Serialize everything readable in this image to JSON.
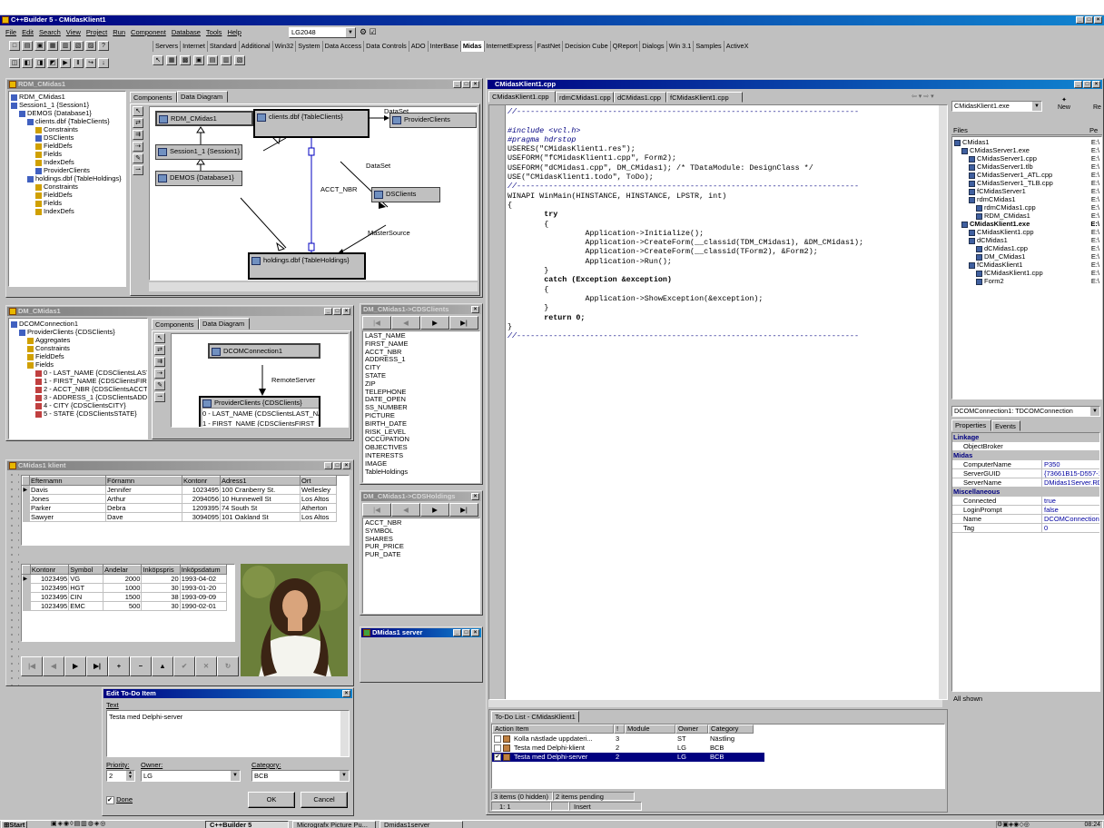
{
  "ide": {
    "title": "C++Builder 5 - CMidasKlient1",
    "menu": [
      "File",
      "Edit",
      "Search",
      "View",
      "Project",
      "Run",
      "Component",
      "Database",
      "Tools",
      "Help"
    ],
    "config_combo": "LG2048",
    "palette_tabs": [
      "Servers",
      "Internet",
      "Standard",
      "Additional",
      "Win32",
      "System",
      "Data Access",
      "Data Controls",
      "ADO",
      "InterBase",
      "Midas",
      "InternetExpress",
      "FastNet",
      "Decision Cube",
      "QReport",
      "Dialogs",
      "Win 3.1",
      "Samples",
      "ActiveX"
    ],
    "selected_palette_tab": "Midas"
  },
  "rdm": {
    "title": "RDM_CMidas1",
    "tree": [
      "RDM_CMidas1",
      "Session1_1 {Session1}",
      "DEMOS {Database1}",
      "clients.dbf {TableClients}",
      "Constraints",
      "DSClients",
      "FieldDefs",
      "Fields",
      "IndexDefs",
      "ProviderClients",
      "holdings.dbf {TableHoldings}",
      "Constraints",
      "FieldDefs",
      "Fields",
      "IndexDefs"
    ],
    "tabs": [
      "Components",
      "Data Diagram"
    ],
    "boxes": {
      "rdm": "RDM_CMidas1",
      "clients": "clients.dbf {TableClients}",
      "provider": "ProviderClients",
      "session": "Session1_1 {Session1}",
      "demos": "DEMOS {Database1}",
      "dsclients": "DSClients",
      "holdings": "holdings.dbf {TableHoldings}"
    },
    "labels": {
      "dataset1": "DataSet",
      "dataset2": "DataSet",
      "acct": "ACCT_NBR",
      "master": "MasterSource"
    }
  },
  "dm": {
    "title": "DM_CMidas1",
    "tree": [
      "DCOMConnection1",
      "ProviderClients {CDSClients}",
      "Aggregates",
      "Constraints",
      "FieldDefs",
      "Fields",
      "0 - LAST_NAME {CDSClientsLAST_NAME}",
      "1 - FIRST_NAME {CDSClientsFIRST_NAME}",
      "2 - ACCT_NBR {CDSClientsACCT_NBR}",
      "3 - ADDRESS_1 {CDSClientsADDRESS_1}",
      "4 - CITY {CDSClientsCITY}",
      "5 - STATE {CDSClientsSTATE}"
    ],
    "tabs": [
      "Components",
      "Data Diagram"
    ],
    "boxes": {
      "dcom": "DCOMConnection1",
      "provider": "ProviderClients {CDSClients}",
      "field0": "0 - LAST_NAME {CDSClientsLAST_NAME}",
      "field1": "1 - FIRST_NAME {CDSClientsFIRST_NAME}"
    },
    "labels": {
      "remote": "RemoteServer"
    }
  },
  "cds_clients": {
    "title": "DM_CMidas1->CDSClients",
    "fields": [
      "LAST_NAME",
      "FIRST_NAME",
      "ACCT_NBR",
      "ADDRESS_1",
      "CITY",
      "STATE",
      "ZIP",
      "TELEPHONE",
      "DATE_OPEN",
      "SS_NUMBER",
      "PICTURE",
      "BIRTH_DATE",
      "RISK_LEVEL",
      "OCCUPATION",
      "OBJECTIVES",
      "INTERESTS",
      "IMAGE",
      "TableHoldings"
    ]
  },
  "cds_holdings": {
    "title": "DM_CMidas1->CDSHoldings",
    "fields": [
      "ACCT_NBR",
      "SYMBOL",
      "SHARES",
      "PUR_PRICE",
      "PUR_DATE"
    ]
  },
  "server_win": {
    "title": "DMidas1 server"
  },
  "klient": {
    "title": "CMidas1 klient",
    "clients_cols": [
      "Efternamn",
      "Förnamn",
      "Kontonr",
      "Adress1",
      "Ort"
    ],
    "clients_rows": [
      [
        "Davis",
        "Jennifer",
        "1023495",
        "100 Cranberry St.",
        "Wellesley"
      ],
      [
        "Jones",
        "Arthur",
        "2094056",
        "10 Hunnewell St",
        "Los Altos"
      ],
      [
        "Parker",
        "Debra",
        "1209395",
        "74 South St",
        "Atherton"
      ],
      [
        "Sawyer",
        "Dave",
        "3094095",
        "101 Oakland St",
        "Los Altos"
      ]
    ],
    "hold_cols": [
      "Kontonr",
      "Symbol",
      "Andelar",
      "Inköpspris",
      "Inköpsdatum"
    ],
    "hold_rows": [
      [
        "1023495",
        "VG",
        "2000",
        "20",
        "1993-04-02"
      ],
      [
        "1023495",
        "HGT",
        "1000",
        "30",
        "1993-01-20"
      ],
      [
        "1023495",
        "CIN",
        "1500",
        "38",
        "1993-09-09"
      ],
      [
        "1023495",
        "EMC",
        "500",
        "30",
        "1990-02-01"
      ]
    ],
    "nav": [
      "|◀",
      "◀",
      "▶",
      "▶|",
      "+",
      "−",
      "▲",
      "✔",
      "✕",
      "↻"
    ]
  },
  "todo_edit": {
    "title": "Edit To-Do Item",
    "text_label": "Text",
    "text_value": "Testa med Delphi-server",
    "priority_label": "Priority:",
    "priority_value": "2",
    "owner_label": "Owner:",
    "owner_value": "LG",
    "category_label": "Category:",
    "category_value": "BCB",
    "done_label": "Done",
    "ok": "OK",
    "cancel": "Cancel"
  },
  "editor": {
    "title": "CMidasKlient1.cpp",
    "tabs": [
      "CMidasKlient1.cpp",
      "rdmCMidas1.cpp",
      "dCMidas1.cpp",
      "fCMidasKlient1.cpp"
    ],
    "code": [
      "//---------------------------------------------------------------------------",
      "",
      "#include <vcl.h>",
      "#pragma hdrstop",
      "USERES(\"CMidasKlient1.res\");",
      "USEFORM(\"fCMidasKlient1.cpp\", Form2);",
      "USEFORM(\"dCMidas1.cpp\", DM_CMidas1); /* TDataModule: DesignClass */",
      "USE(\"CMidasKlient1.todo\", ToDo);",
      "//---------------------------------------------------------------------------",
      "WINAPI WinMain(HINSTANCE, HINSTANCE, LPSTR, int)",
      "{",
      "        try",
      "        {",
      "                 Application->Initialize();",
      "                 Application->CreateForm(__classid(TDM_CMidas1), &DM_CMidas1);",
      "                 Application->CreateForm(__classid(TForm2), &Form2);",
      "                 Application->Run();",
      "        }",
      "        catch (Exception &exception)",
      "        {",
      "                 Application->ShowException(&exception);",
      "        }",
      "        return 0;",
      "}",
      "//---------------------------------------------------------------------------"
    ]
  },
  "todo_list": {
    "title": "To-Do List - CMidasKlient1",
    "cols": [
      "Action Item",
      "!",
      "Module",
      "Owner",
      "Category"
    ],
    "rows": [
      {
        "text": "Kolla nästlade uppdateri...",
        "pri": "3",
        "owner": "ST",
        "cat": "Nästling",
        "done": false
      },
      {
        "text": "Testa med Delphi-klient",
        "pri": "2",
        "owner": "LG",
        "cat": "BCB",
        "done": false
      },
      {
        "text": "Testa med Delphi-server",
        "pri": "2",
        "owner": "LG",
        "cat": "BCB",
        "done": true
      }
    ],
    "status1": "3 items (0 hidden)",
    "status2": "2 items pending"
  },
  "editor_status": {
    "pos": "1: 1",
    "mode": "Insert"
  },
  "pm": {
    "combo": "CMidasKlient1.exe",
    "new_label": "New",
    "re_label": "Re",
    "col_files": "Files",
    "col_pe": "Pe",
    "items": [
      "CMidas1",
      "CMidasServer1.exe",
      "CMidasServer1.cpp",
      "CMidasServer1.tlb",
      "CMidasServer1_ATL.cpp",
      "CMidasServer1_TLB.cpp",
      "fCMidasServer1",
      "rdmCMidas1",
      "rdmCMidas1.cpp",
      "RDM_CMidas1",
      "CMidasKlient1.exe",
      "CMidasKlient1.cpp",
      "dCMidas1",
      "dCMidas1.cpp",
      "DM_CMidas1",
      "fCMidasKlient1",
      "fCMidasKlient1.cpp",
      "Form2"
    ]
  },
  "inspector": {
    "combo": "DCOMConnection1: TDCOMConnection",
    "tabs": [
      "Properties",
      "Events"
    ],
    "rows": [
      {
        "cat": true,
        "k": "Linkage"
      },
      {
        "k": "ObjectBroker",
        "v": ""
      },
      {
        "cat": true,
        "k": "Midas"
      },
      {
        "k": "ComputerName",
        "v": "P350"
      },
      {
        "k": "ServerGUID",
        "v": "{73661B15-D557-11"
      },
      {
        "k": "ServerName",
        "v": "DMidas1Server.RD"
      },
      {
        "cat": true,
        "k": "Miscellaneous"
      },
      {
        "k": "Connected",
        "v": "true"
      },
      {
        "k": "LoginPrompt",
        "v": "false"
      },
      {
        "k": "Name",
        "v": "DCOMConnection1"
      },
      {
        "k": "Tag",
        "v": "0"
      }
    ],
    "status": "All shown"
  },
  "taskbar": {
    "start": "Start",
    "buttons": [
      "C++Builder 5",
      "Micrografx Picture Pu...",
      "Dmidas1server"
    ],
    "clock": "08:24"
  }
}
